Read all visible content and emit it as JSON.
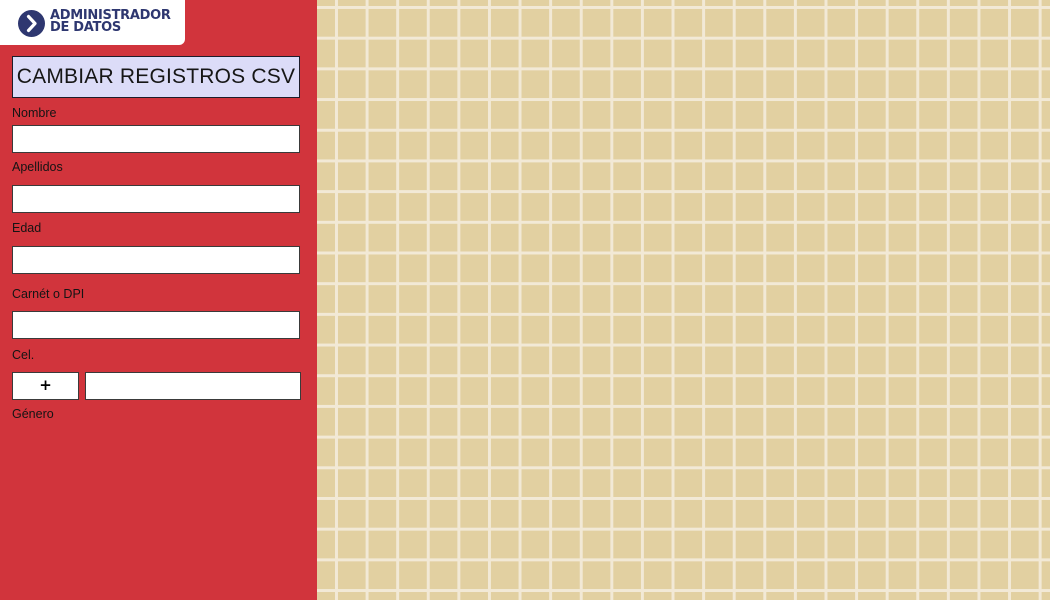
{
  "app": {
    "logo_line1": "ADMINISTRADOR",
    "logo_line2": "DE DATOS",
    "logo_icon": "chevron-right-icon"
  },
  "form": {
    "csv_button_label": "CAMBIAR REGISTROS CSV",
    "nombre_label": "Nombre",
    "nombre_value": "",
    "apellidos_label": "Apellidos",
    "apellidos_value": "",
    "edad_label": "Edad",
    "edad_value": "",
    "carnet_label": "Carnét o DPI",
    "carnet_value": "",
    "cel_label": "Cel.",
    "country_code_label": "+",
    "cel_value": "",
    "genero_label": "Género"
  },
  "colors": {
    "panel": "#d1343c",
    "canvas": "#e2d0a1",
    "grid_lines": "#f2e9d6",
    "logo_accent": "#2e3770",
    "csv_button": "#dcdcf8"
  }
}
